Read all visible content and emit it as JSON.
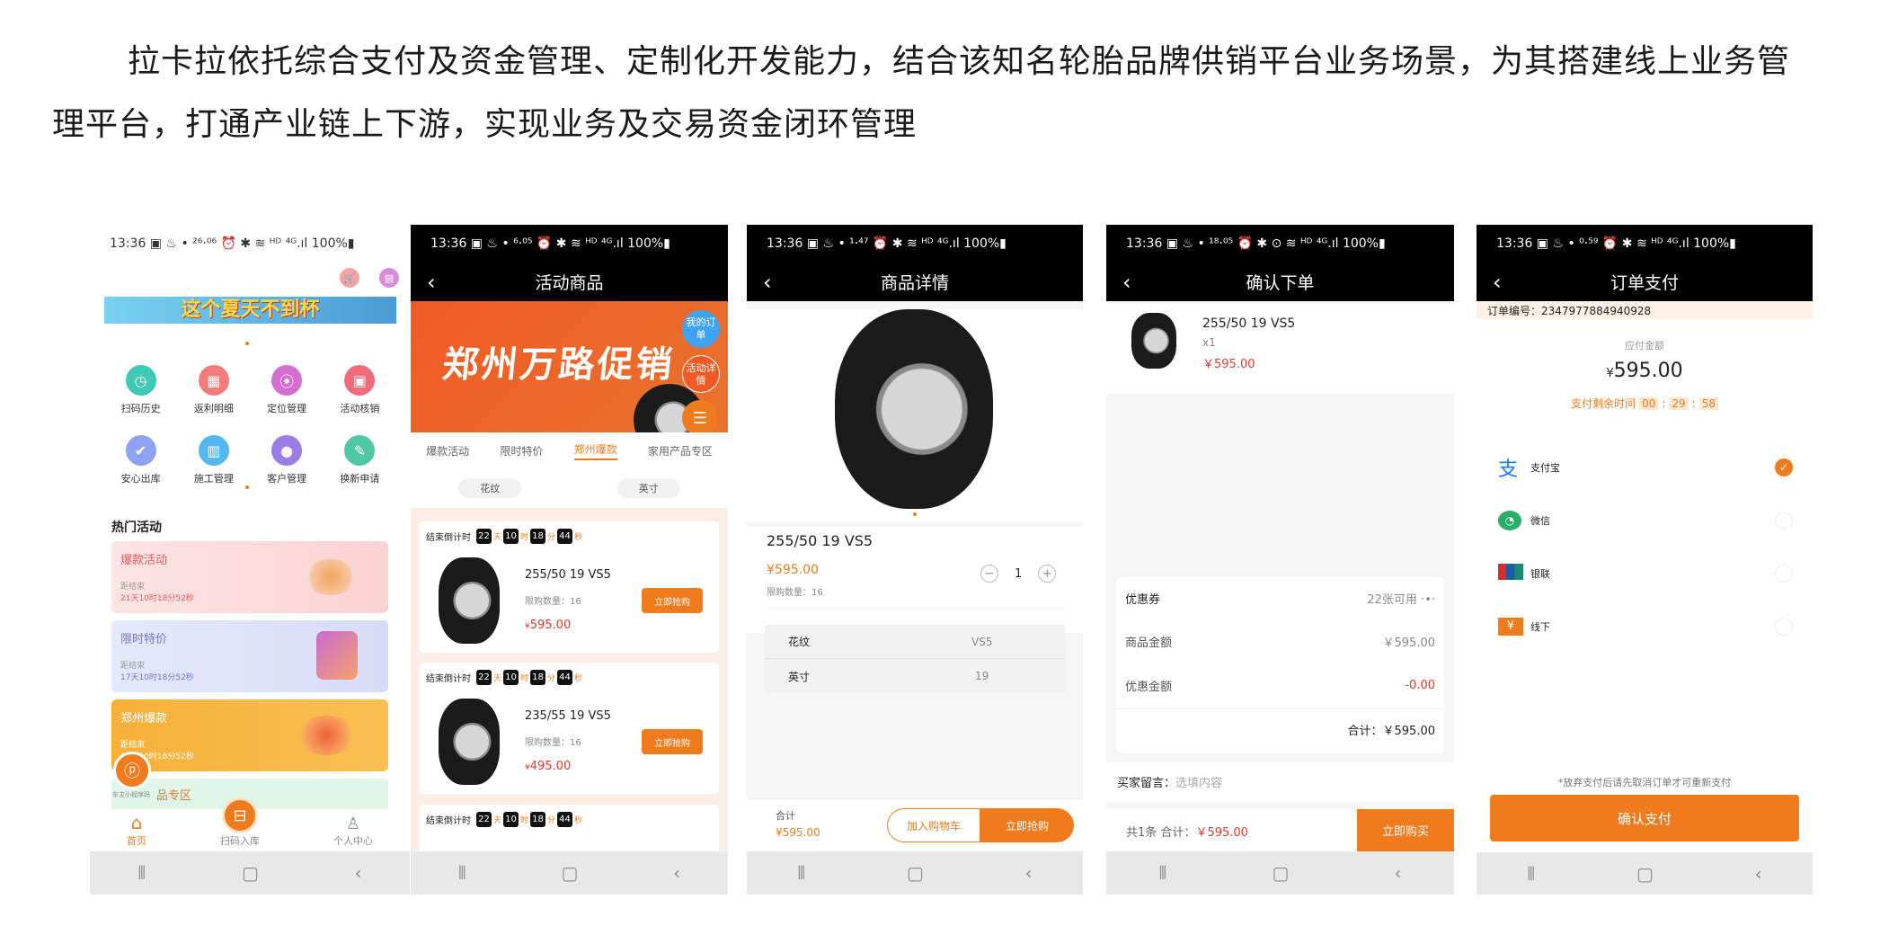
{
  "intro": "拉卡拉依托综合支付及资金管理、定制化开发能力，结合该知名轮胎品牌供销平台业务场景，为其搭建线上业务管理平台，打通产业链上下游，实现业务及交易资金闭环管理",
  "status": {
    "time": "13:36",
    "battery": "100%",
    "p1": "13:36 ▣ ♨ •  ²⁶·⁰⁶ ⏰ ✱ ≋ ᴴᴰ ⁴ᴳ.ıl 100%▮",
    "p2": "13:36 ▣ ♨ •  ⁶·⁰⁵ ⏰ ✱ ≋ ᴴᴰ ⁴ᴳ.ıl 100%▮",
    "p3": "13:36 ▣ ♨ •  ¹·⁴⁷ ⏰ ✱ ≋ ᴴᴰ ⁴ᴳ.ıl 100%▮",
    "p4": "13:36 ▣ ♨ •  ¹⁸·⁰⁵ ⏰ ✱ ⊙ ≋ ᴴᴰ ⁴ᴳ.ıl 100%▮",
    "p5": "13:36 ▣ ♨ •  ⁰·⁵⁹ ⏰ ✱ ≋ ᴴᴰ ⁴ᴳ.ıl 100%▮"
  },
  "p1": {
    "banner": "这个夏天不到杯",
    "icons": [
      "扫码历史",
      "返利明细",
      "定位管理",
      "活动核销",
      "安心出库",
      "施工管理",
      "客户管理",
      "换新申请"
    ],
    "section_title": "热门活动",
    "cards": [
      {
        "title": "爆款活动",
        "sub": "距结束",
        "time": "21天10时18分52秒"
      },
      {
        "title": "限时特价",
        "sub": "距结束",
        "time": "17天10时18分52秒"
      },
      {
        "title": "郑州爆款",
        "sub": "距结束",
        "time": "21天10时18分52秒"
      },
      {
        "title": "品专区",
        "sub": "",
        "time": ""
      }
    ],
    "float_label": "车主小程序码",
    "tabs": [
      "首页",
      "扫码入库",
      "个人中心"
    ]
  },
  "p2": {
    "title": "活动商品",
    "banner": "郑州万路促销",
    "my_order": "我的订单",
    "detail": "活动详情",
    "tabs": [
      "爆款活动",
      "限时特价",
      "郑州爆款",
      "家用产品专区"
    ],
    "filters": [
      "花纹",
      "英寸"
    ],
    "countdown_label": "结束倒计时",
    "countdown": [
      "22",
      "10",
      "18",
      "44"
    ],
    "units": [
      "天",
      "时",
      "分",
      "秒"
    ],
    "products": [
      {
        "name": "255/50 19 VS5",
        "limit": "限购数量：16",
        "price": "595.00",
        "btn": "立即抢购"
      },
      {
        "name": "235/55 19 VS5",
        "limit": "限购数量：16",
        "price": "495.00",
        "btn": "立即抢购"
      }
    ]
  },
  "p3": {
    "title": "商品详情",
    "name": "255/50 19 VS5",
    "price": "¥595.00",
    "limit": "限购数量：16",
    "qty": "1",
    "spec": [
      [
        "花纹",
        "VS5"
      ],
      [
        "英寸",
        "19"
      ]
    ],
    "total_label": "合计",
    "total": "¥595.00",
    "add_cart": "加入购物车",
    "buy": "立即抢购"
  },
  "p4": {
    "title": "确认下单",
    "name": "255/50 19 VS5",
    "qty": "x1",
    "price": "￥595.00",
    "coupon_label": "优惠券",
    "coupon_val": "22张可用",
    "goods_label": "商品金额",
    "goods_val": "￥595.00",
    "disc_label": "优惠金额",
    "disc_val": "-0.00",
    "sum": "合计：￥595.00",
    "note_label": "买家留言：",
    "note_ph": "选填内容",
    "footer_count": "共1条",
    "footer_total_label": "合计：",
    "footer_total": "￥595.00",
    "buy": "立即购买"
  },
  "p5": {
    "title": "订单支付",
    "order_no": "订单编号：2347977884940928",
    "due_label": "应付金额",
    "amount": "595.00",
    "remain_label": "支付剩余时间",
    "remain": [
      "00",
      "29",
      "58"
    ],
    "methods": [
      "支付宝",
      "微信",
      "银联",
      "线下"
    ],
    "tip": "*放弃支付后请先取消订单才可重新支付",
    "confirm": "确认支付"
  },
  "colors": {
    "accent": "#f07b1d",
    "price": "#e8372a"
  }
}
